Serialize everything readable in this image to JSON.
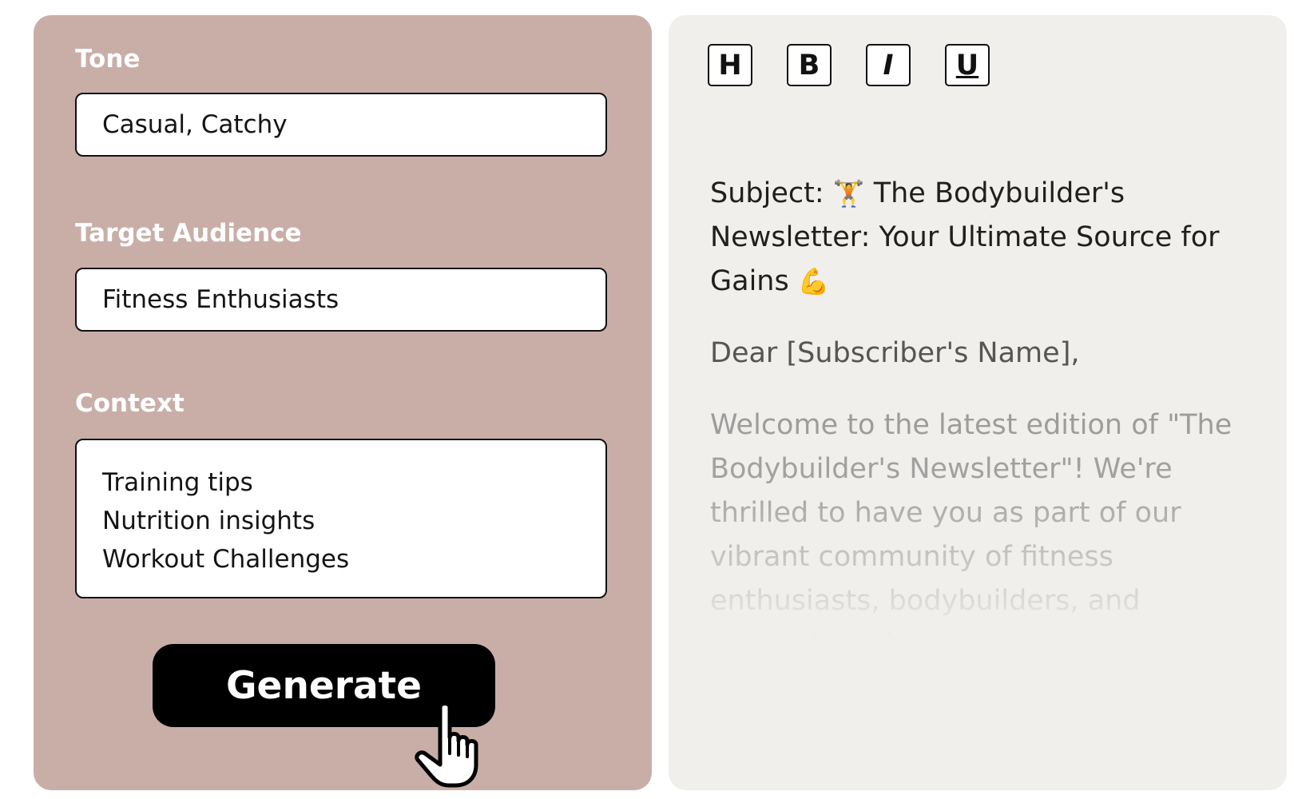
{
  "form": {
    "tone_label": "Tone",
    "tone_value": "Casual, Catchy",
    "audience_label": "Target Audience",
    "audience_value": "Fitness Enthusiasts",
    "context_label": "Context",
    "context_lines": [
      "Training tips",
      "Nutrition insights",
      "Workout Challenges"
    ],
    "generate_label": "Generate"
  },
  "toolbar": {
    "heading_label": "H",
    "bold_label": "B",
    "italic_label": "I",
    "underline_label": "U"
  },
  "output": {
    "subject_prefix": "Subject: ",
    "subject_emoji": "🏋️",
    "subject_text": " The Bodybuilder's Newsletter: Your Ultimate Source for Gains ",
    "subject_emoji_end": "💪",
    "greeting": "Dear [Subscriber's Name],",
    "body": "Welcome to the latest edition of \"The Bodybuilder's Newsletter\"! We're thrilled to have you as part of our vibrant community of fitness enthusiasts, bodybuilders, and strength seekers"
  },
  "colors": {
    "form_panel_bg": "#c9aea8",
    "editor_panel_bg": "#f0efeb",
    "button_bg": "#000000"
  }
}
